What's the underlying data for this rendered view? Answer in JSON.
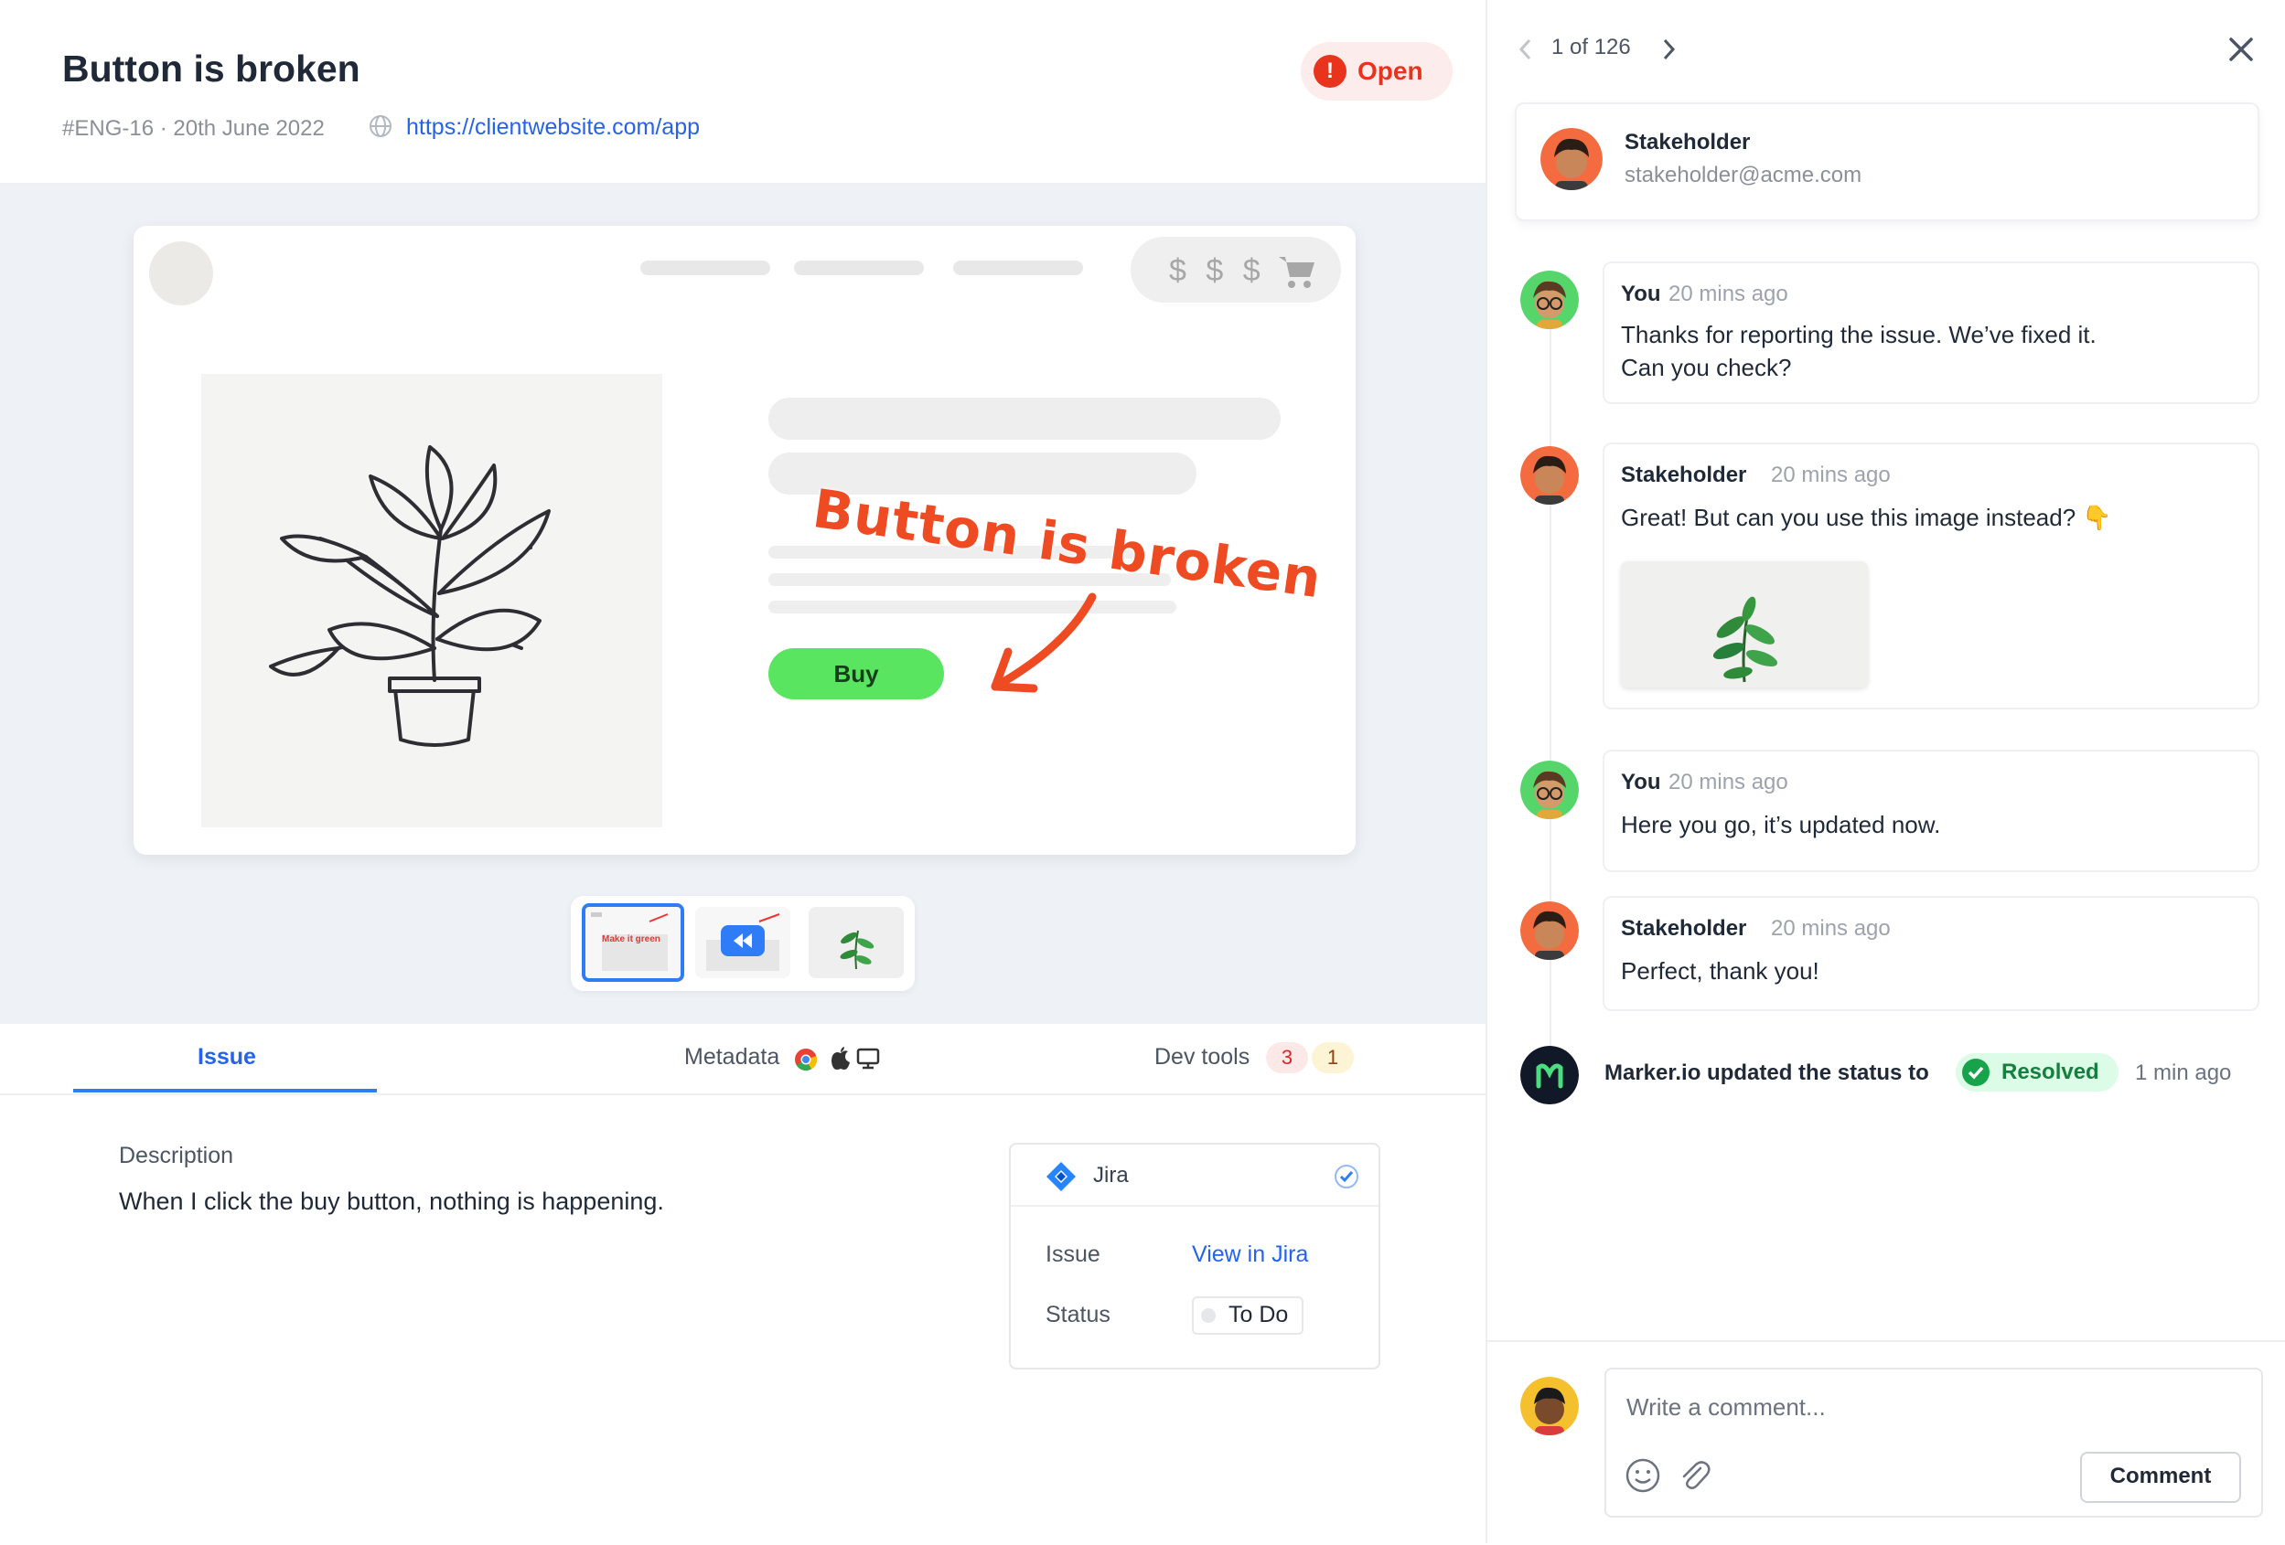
{
  "issue": {
    "title": "Button is broken",
    "meta": "#ENG-16 · 20th June 2022",
    "url": "https://clientwebsite.com/app",
    "status_label": "Open"
  },
  "preview": {
    "currency_placeholder": "$ $ $",
    "buy_label": "Buy",
    "annotation": "Button is broken",
    "thumb_texts": [
      "Make it green"
    ]
  },
  "tabs": [
    {
      "label": "Issue",
      "active": true
    },
    {
      "label": "Metadata"
    },
    {
      "label": "Dev tools",
      "counts": [
        "3",
        "1"
      ]
    }
  ],
  "details": {
    "description_label": "Description",
    "description_text": "When I click the buy button, nothing is happening.",
    "integration": {
      "name": "Jira",
      "issue_label": "Issue",
      "issue_link": "View in Jira",
      "status_label": "Status",
      "status_value": "To Do"
    }
  },
  "sidebar": {
    "pager": "1 of 126",
    "reporter": {
      "name": "Stakeholder",
      "email": "stakeholder@acme.com"
    },
    "messages": [
      {
        "author": "You",
        "time": "20 mins ago",
        "lines": [
          "Thanks for reporting the issue. We’ve fixed it.",
          "Can you check?"
        ]
      },
      {
        "author": "Stakeholder",
        "time": "20 mins ago",
        "lines": [
          "Great! But can you use this image instead? 👇"
        ]
      },
      {
        "author": "You",
        "time": "20 mins ago",
        "lines": [
          "Here you go, it’s updated now."
        ]
      },
      {
        "author": "Stakeholder",
        "time": "20 mins ago",
        "lines": [
          "Perfect, thank you!"
        ]
      }
    ],
    "status_event": {
      "text": "Marker.io updated the status to",
      "status": "Resolved",
      "time": "1 min ago"
    },
    "composer": {
      "placeholder": "Write a comment...",
      "button": "Comment"
    }
  },
  "colors": {
    "accent": "#2f7df6",
    "open": "#e8341c",
    "resolved": "#15803d",
    "buy": "#59e560",
    "annotation": "#ee4b22"
  },
  "icons": [
    "info-icon",
    "globe-icon",
    "cart-icon",
    "plant-illustration",
    "rewind-icon",
    "chrome-icon",
    "apple-icon",
    "monitor-icon",
    "jira-icon",
    "check-circle-icon",
    "chevron-left-icon",
    "chevron-right-icon",
    "close-icon",
    "emoji-icon",
    "paperclip-icon",
    "marker-logo-icon"
  ]
}
